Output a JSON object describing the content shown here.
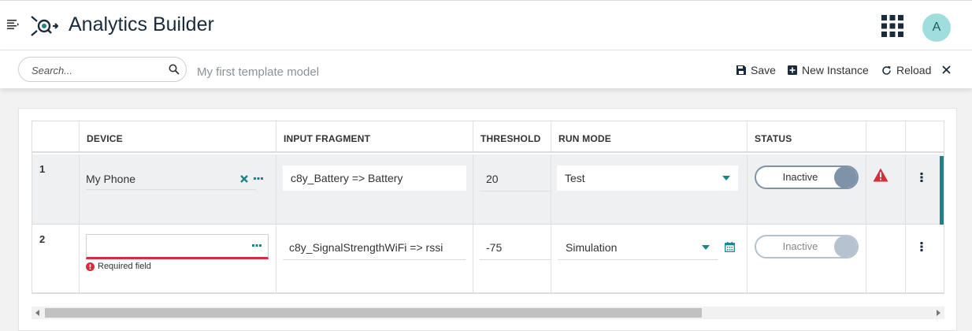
{
  "header": {
    "title": "Analytics Builder",
    "avatar_initial": "A"
  },
  "toolbar": {
    "search_placeholder": "Search...",
    "model_name": "My first template model",
    "save_label": "Save",
    "new_instance_label": "New Instance",
    "reload_label": "Reload"
  },
  "table": {
    "columns": [
      "DEVICE",
      "INPUT FRAGMENT",
      "THRESHOLD",
      "RUN MODE",
      "STATUS"
    ],
    "rows": [
      {
        "number": "1",
        "device": "My Phone",
        "input_fragment": "c8y_Battery => Battery",
        "threshold": "20",
        "run_mode": "Test",
        "status": "Inactive"
      },
      {
        "number": "2",
        "device": "",
        "device_error": "Required field",
        "input_fragment": "c8y_SignalStrengthWiFi => rssi",
        "threshold": "-75",
        "run_mode": "Simulation",
        "status": "Inactive"
      }
    ]
  },
  "colors": {
    "accent_teal": "#1a8585",
    "error_red": "#d32f3a",
    "title_dark": "#1a2b3c",
    "avatar_bg": "#9fdedd"
  },
  "icons": {
    "menu": "hamburger-icon",
    "logo": "analytics-builder-logo-icon",
    "apps": "apps-grid-icon",
    "search": "search-icon",
    "save": "floppy-disk-icon",
    "new_instance": "plus-square-icon",
    "reload": "refresh-icon",
    "close": "close-icon",
    "warning": "warning-triangle-icon",
    "calendar": "calendar-icon"
  }
}
